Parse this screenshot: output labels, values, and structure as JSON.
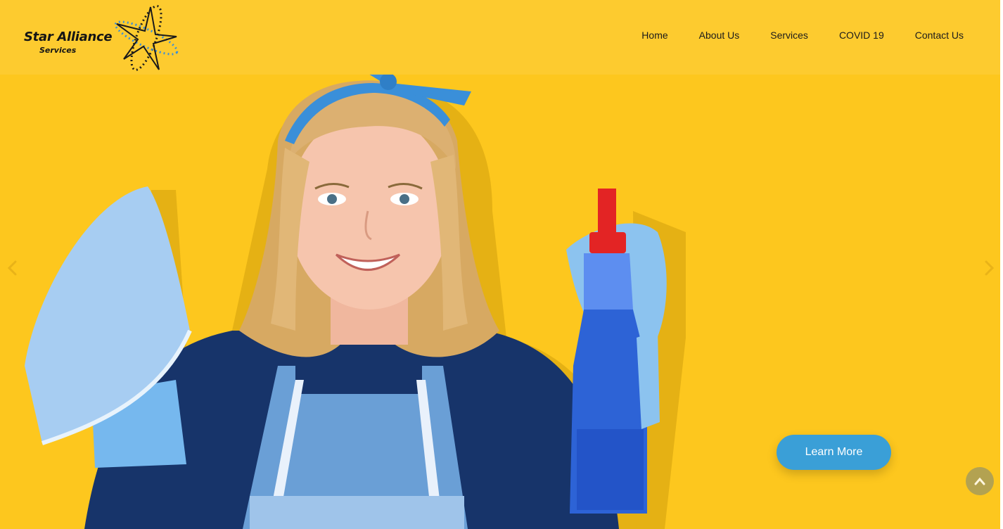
{
  "brand": {
    "title": "Star Alliance",
    "subtitle": "Services"
  },
  "nav": {
    "items": [
      "Home",
      "About Us",
      "Services",
      "COVID 19",
      "Contact Us"
    ]
  },
  "hero": {
    "button_label": "Learn More"
  },
  "carousel": {
    "prev_icon": "chevron-left-icon",
    "next_icon": "chevron-right-icon"
  },
  "scroll_top": {
    "icon": "chevron-up-icon"
  },
  "colors": {
    "background": "#fdc71e",
    "header": "#fdcb2f",
    "button": "#3a9fd7",
    "scroll_top": "#a79c5b"
  }
}
